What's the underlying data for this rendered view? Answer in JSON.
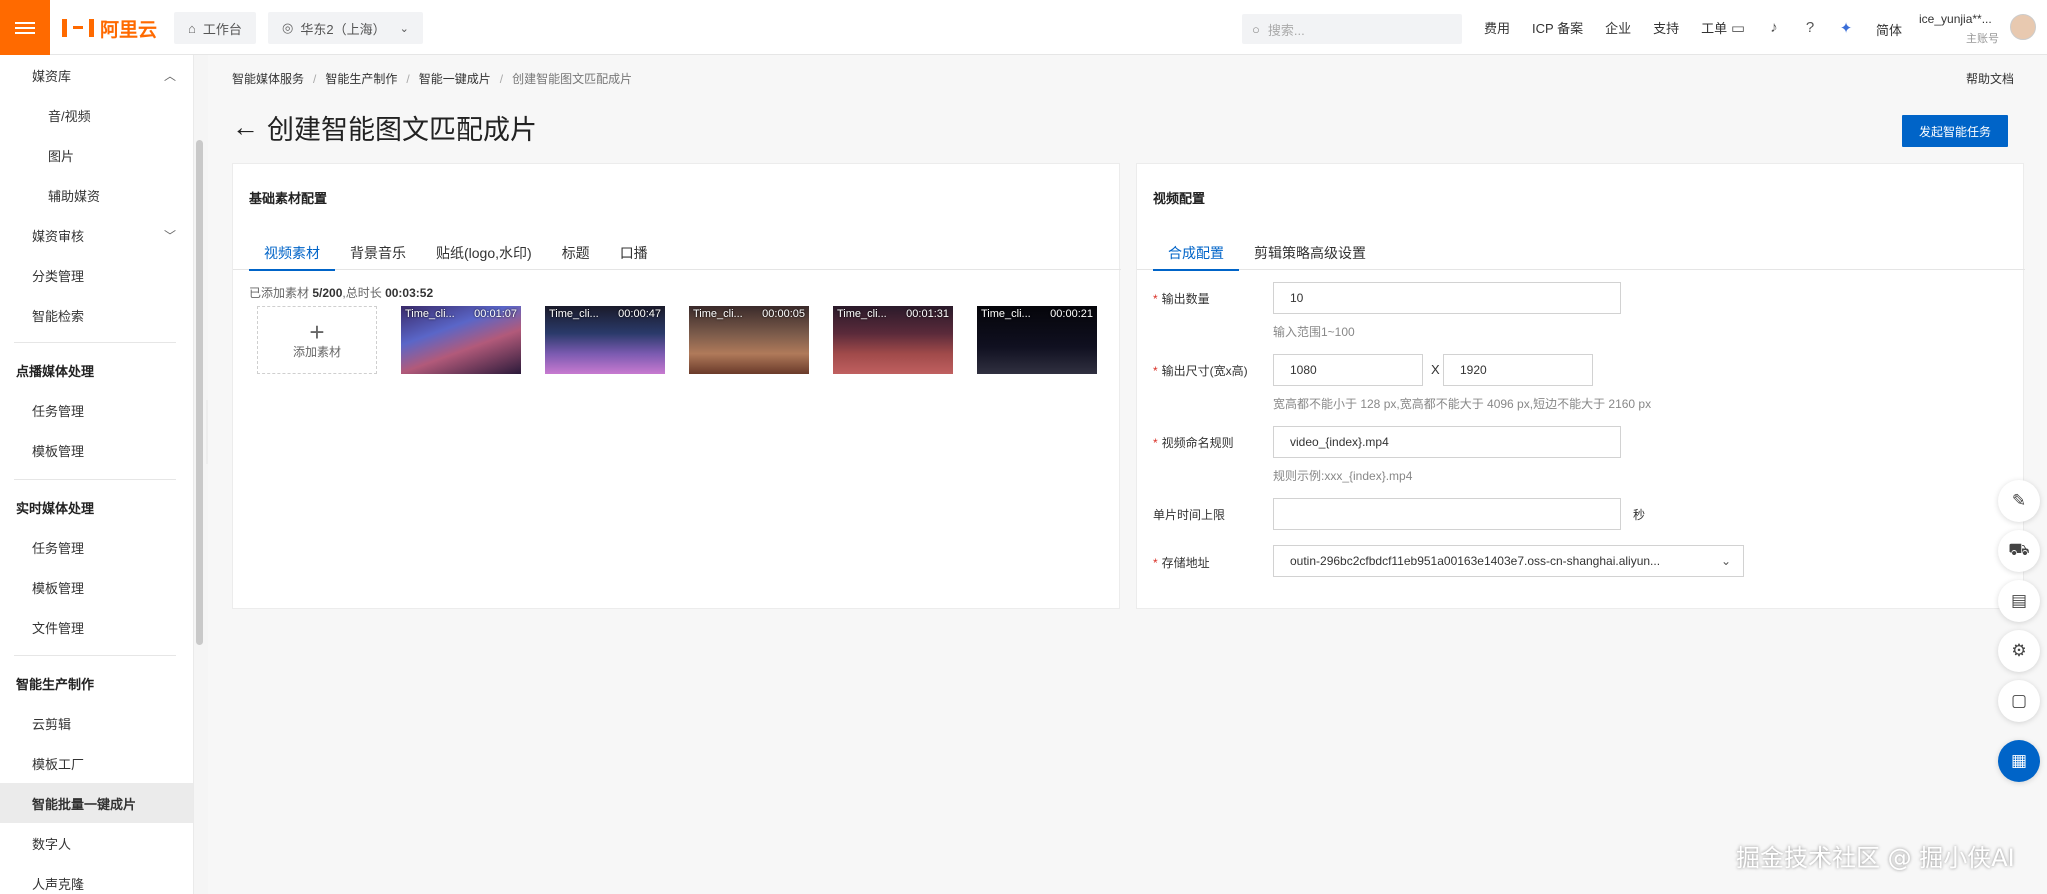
{
  "topbar": {
    "logo_text": "阿里云",
    "workbench": "工作台",
    "region": "华东2（上海）",
    "search_placeholder": "搜索...",
    "links": [
      "费用",
      "ICP 备案",
      "企业",
      "支持",
      "工单"
    ],
    "lang": "简体",
    "username": "ice_yunjia**...",
    "role": "主账号",
    "accent_color": "#ff6a00"
  },
  "sidebar": {
    "items": [
      {
        "label": "媒资库",
        "type": "group-sub",
        "chevron": "up"
      },
      {
        "label": "音/视频",
        "type": "leaf2"
      },
      {
        "label": "图片",
        "type": "leaf2"
      },
      {
        "label": "辅助媒资",
        "type": "leaf2"
      },
      {
        "label": "媒资审核",
        "type": "group-sub",
        "chevron": "down"
      },
      {
        "label": "分类管理",
        "type": "leaf"
      },
      {
        "label": "智能检索",
        "type": "leaf"
      },
      {
        "label": "点播媒体处理",
        "type": "group"
      },
      {
        "label": "任务管理",
        "type": "leaf"
      },
      {
        "label": "模板管理",
        "type": "leaf"
      },
      {
        "label": "实时媒体处理",
        "type": "group"
      },
      {
        "label": "任务管理",
        "type": "leaf"
      },
      {
        "label": "模板管理",
        "type": "leaf"
      },
      {
        "label": "文件管理",
        "type": "leaf"
      },
      {
        "label": "智能生产制作",
        "type": "group"
      },
      {
        "label": "云剪辑",
        "type": "leaf"
      },
      {
        "label": "模板工厂",
        "type": "leaf"
      },
      {
        "label": "智能批量一键成片",
        "type": "leaf",
        "active": true
      },
      {
        "label": "数字人",
        "type": "leaf"
      },
      {
        "label": "人声克隆",
        "type": "leaf"
      }
    ]
  },
  "breadcrumb": [
    "智能媒体服务",
    "智能生产制作",
    "智能一键成片",
    "创建智能图文匹配成片"
  ],
  "help_link": "帮助文档",
  "page_title": "创建智能图文匹配成片",
  "primary_button": "发起智能任务",
  "left_card": {
    "title": "基础素材配置",
    "tabs": [
      "视频素材",
      "背景音乐",
      "贴纸(logo,水印)",
      "标题",
      "口播"
    ],
    "active_tab": 0,
    "added_prefix": "已添加素材",
    "added_count": "5/200",
    "duration_prefix": ",总时长",
    "duration": "00:03:52",
    "add_label": "添加素材",
    "clips": [
      {
        "name": "Time_cli...",
        "duration": "00:01:07"
      },
      {
        "name": "Time_cli...",
        "duration": "00:00:47"
      },
      {
        "name": "Time_cli...",
        "duration": "00:00:05"
      },
      {
        "name": "Time_cli...",
        "duration": "00:01:31"
      },
      {
        "name": "Time_cli...",
        "duration": "00:00:21"
      }
    ]
  },
  "right_card": {
    "title": "视频配置",
    "tabs": [
      "合成配置",
      "剪辑策略高级设置"
    ],
    "active_tab": 0,
    "output_count": {
      "label": "输出数量",
      "value": "10",
      "hint": "输入范围1~100"
    },
    "output_size": {
      "label": "输出尺寸(宽x高)",
      "width": "1080",
      "sep": "X",
      "height": "1920",
      "hint": "宽高都不能小于 128 px,宽高都不能大于 4096 px,短边不能大于 2160 px"
    },
    "naming": {
      "label": "视频命名规则",
      "value": "video_{index}.mp4",
      "hint": "规则示例:xxx_{index}.mp4"
    },
    "time_limit": {
      "label": "单片时间上限",
      "value": "",
      "unit": "秒"
    },
    "storage": {
      "label": "存储地址",
      "value": "outin-296bc2cfbdcf11eb951a00163e1403e7.oss-cn-shanghai.aliyun..."
    }
  },
  "watermark": "掘金技术社区 @ 掘小侠AI"
}
